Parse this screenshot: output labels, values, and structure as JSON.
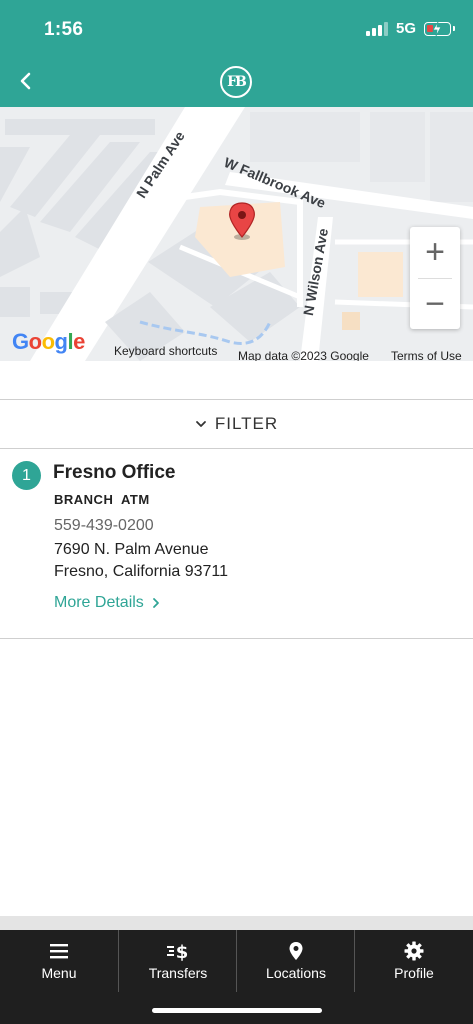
{
  "status_bar": {
    "time": "1:56",
    "network": "5G"
  },
  "header": {
    "logo_text": "FB"
  },
  "map": {
    "streets": [
      "N Palm Ave",
      "W Fallbrook Ave",
      "N Wilson Ave"
    ],
    "google_logo": [
      "G",
      "o",
      "o",
      "g",
      "l",
      "e"
    ],
    "keyboard_shortcuts": "Keyboard shortcuts",
    "map_data": "Map data ©2023 Google",
    "terms": "Terms of Use",
    "zoom_in": "+",
    "zoom_out": "−"
  },
  "filter": {
    "label": "FILTER"
  },
  "location": {
    "number": "1",
    "name": "Fresno Office",
    "tags": "BRANCH ATM",
    "phone": "559-439-0200",
    "address_line1": "7690 N. Palm Avenue",
    "address_line2": "Fresno, California 93711",
    "more_details": "More Details"
  },
  "nav": {
    "items": [
      {
        "label": "Menu",
        "icon": "menu-icon"
      },
      {
        "label": "Transfers",
        "icon": "transfers-icon"
      },
      {
        "label": "Locations",
        "icon": "location-pin-icon"
      },
      {
        "label": "Profile",
        "icon": "gear-icon"
      }
    ]
  },
  "colors": {
    "brand": "#2fa596",
    "nav_bg": "#1f1f1f",
    "pin": "#e84545"
  }
}
